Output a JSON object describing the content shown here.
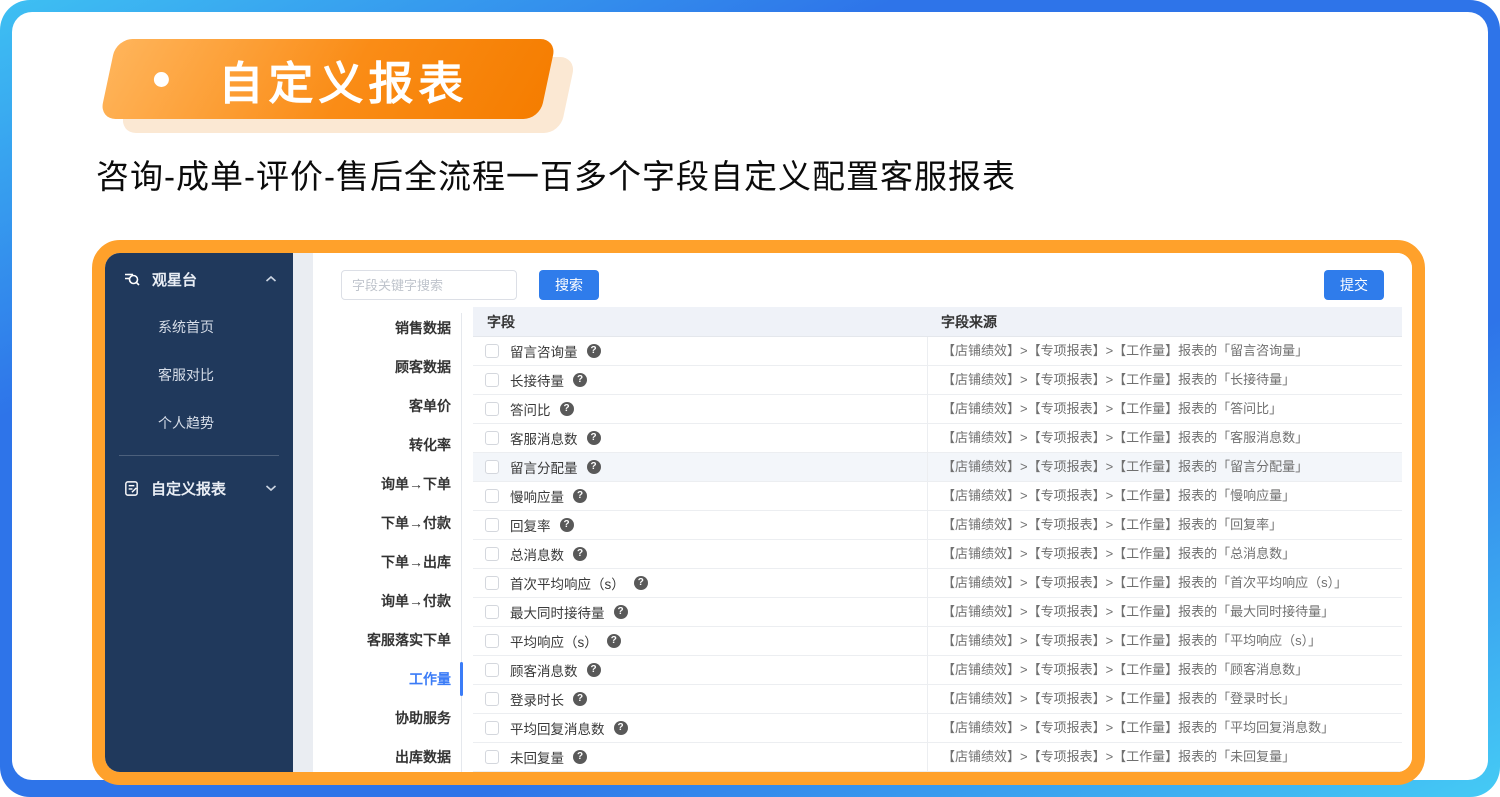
{
  "header": {
    "badge_label": "自定义报表",
    "subtitle": "咨询-成单-评价-售后全流程一百多个字段自定义配置客服报表"
  },
  "sidebar": {
    "groups": [
      {
        "label": "观星台",
        "icon": "telescope-search-icon",
        "chevron": "up",
        "items": [
          "系统首页",
          "客服对比",
          "个人趋势"
        ]
      },
      {
        "label": "自定义报表",
        "icon": "report-document-icon",
        "chevron": "down",
        "items": []
      }
    ]
  },
  "toolbar": {
    "search_placeholder": "字段关键字搜索",
    "search_button": "搜索",
    "submit_button": "提交"
  },
  "categories": {
    "items": [
      "销售数据",
      "顾客数据",
      "客单价",
      "转化率",
      "询单→下单",
      "下单→付款",
      "下单→出库",
      "询单→付款",
      "客服落实下单",
      "工作量",
      "协助服务",
      "出库数据"
    ],
    "active_index": 9
  },
  "table": {
    "columns": [
      "字段",
      "字段来源"
    ],
    "rows": [
      {
        "field": "留言咨询量",
        "source": "【店铺绩效】>【专项报表】>【工作量】报表的「留言咨询量」",
        "highlighted": false
      },
      {
        "field": "长接待量",
        "source": "【店铺绩效】>【专项报表】>【工作量】报表的「长接待量」",
        "highlighted": false
      },
      {
        "field": "答问比",
        "source": "【店铺绩效】>【专项报表】>【工作量】报表的「答问比」",
        "highlighted": false
      },
      {
        "field": "客服消息数",
        "source": "【店铺绩效】>【专项报表】>【工作量】报表的「客服消息数」",
        "highlighted": false
      },
      {
        "field": "留言分配量",
        "source": "【店铺绩效】>【专项报表】>【工作量】报表的「留言分配量」",
        "highlighted": true
      },
      {
        "field": "慢响应量",
        "source": "【店铺绩效】>【专项报表】>【工作量】报表的「慢响应量」",
        "highlighted": false
      },
      {
        "field": "回复率",
        "source": "【店铺绩效】>【专项报表】>【工作量】报表的「回复率」",
        "highlighted": false
      },
      {
        "field": "总消息数",
        "source": "【店铺绩效】>【专项报表】>【工作量】报表的「总消息数」",
        "highlighted": false
      },
      {
        "field": "首次平均响应（s）",
        "source": "【店铺绩效】>【专项报表】>【工作量】报表的「首次平均响应（s）」",
        "highlighted": false
      },
      {
        "field": "最大同时接待量",
        "source": "【店铺绩效】>【专项报表】>【工作量】报表的「最大同时接待量」",
        "highlighted": false
      },
      {
        "field": "平均响应（s）",
        "source": "【店铺绩效】>【专项报表】>【工作量】报表的「平均响应（s）」",
        "highlighted": false
      },
      {
        "field": "顾客消息数",
        "source": "【店铺绩效】>【专项报表】>【工作量】报表的「顾客消息数」",
        "highlighted": false
      },
      {
        "field": "登录时长",
        "source": "【店铺绩效】>【专项报表】>【工作量】报表的「登录时长」",
        "highlighted": false
      },
      {
        "field": "平均回复消息数",
        "source": "【店铺绩效】>【专项报表】>【工作量】报表的「平均回复消息数」",
        "highlighted": false
      },
      {
        "field": "未回复量",
        "source": "【店铺绩效】>【专项报表】>【工作量】报表的「未回复量」",
        "highlighted": false
      }
    ]
  },
  "colors": {
    "frame_blue": "#2e74e9",
    "frame_cyan": "#45cbf5",
    "panel_border_orange": "#ffa12b",
    "badge_gradient_start": "#ffb45a",
    "badge_gradient_end": "#f57d00",
    "badge_shadow": "#fbe8d3",
    "sidebar_bg": "#20395c",
    "button_blue": "#2f7ceb",
    "active_category_blue": "#3b7cf7",
    "table_header_bg": "#eff2f8",
    "highlighted_row_bg": "#f3f6fa"
  }
}
